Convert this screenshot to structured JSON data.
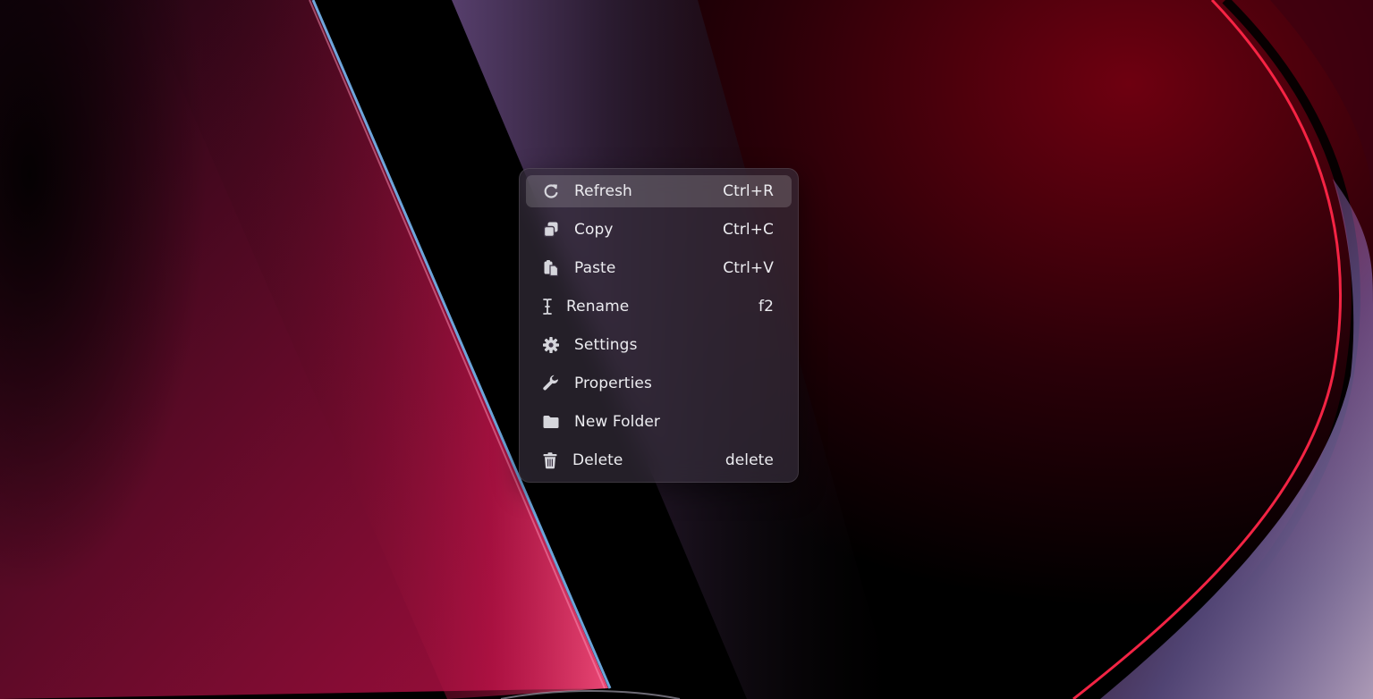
{
  "wallpaper": {
    "colors": {
      "left_ribbon": "#9a0d38",
      "left_ribbon_edge": "#6fb4ff",
      "center_band": "#4b3656",
      "right_ribbon": "#6b0010",
      "right_edge": "#ff2a47",
      "far_right_glow": "#b9a5ff",
      "background": "#000000"
    }
  },
  "context_menu": {
    "items": [
      {
        "label": "Refresh",
        "shortcut": "Ctrl+R",
        "icon": "refresh-icon",
        "active": true
      },
      {
        "label": "Copy",
        "shortcut": "Ctrl+C",
        "icon": "copy-icon",
        "active": false
      },
      {
        "label": "Paste",
        "shortcut": "Ctrl+V",
        "icon": "paste-icon",
        "active": false
      },
      {
        "label": "Rename",
        "shortcut": "f2",
        "icon": "text-cursor-icon",
        "active": false
      },
      {
        "label": "Settings",
        "shortcut": "",
        "icon": "gear-icon",
        "active": false
      },
      {
        "label": "Properties",
        "shortcut": "",
        "icon": "wrench-icon",
        "active": false
      },
      {
        "label": "New Folder",
        "shortcut": "",
        "icon": "folder-icon",
        "active": false
      },
      {
        "label": "Delete",
        "shortcut": "delete",
        "icon": "trash-icon",
        "active": false
      }
    ]
  },
  "theme": {
    "menu_text": "#ececf0",
    "icon_color": "#d6d6dc",
    "hover_bg": "rgba(255,255,255,0.16)"
  }
}
